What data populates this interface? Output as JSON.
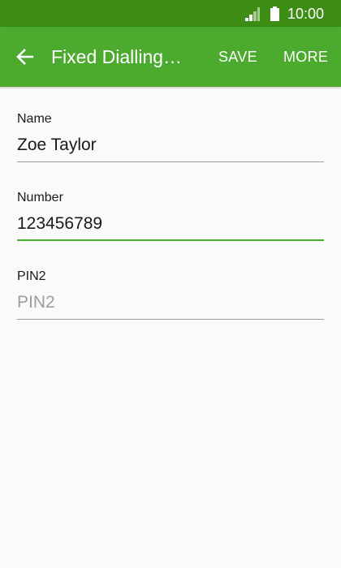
{
  "status_bar": {
    "time": "10:00",
    "icons": [
      "signal-icon",
      "battery-icon"
    ]
  },
  "app_bar": {
    "title": "Fixed Dialling…",
    "back_icon": "back-arrow-icon",
    "actions": {
      "save_label": "SAVE",
      "more_label": "MORE"
    }
  },
  "form": {
    "name": {
      "label": "Name",
      "value": "Zoe Taylor",
      "placeholder": ""
    },
    "number": {
      "label": "Number",
      "value": "123456789",
      "placeholder": ""
    },
    "pin2": {
      "label": "PIN2",
      "value": "",
      "placeholder": "PIN2"
    }
  },
  "colors": {
    "status_bar": "#3d8d15",
    "app_bar": "#4caa2f",
    "accent": "#4caa2f",
    "background": "#fafafa"
  }
}
